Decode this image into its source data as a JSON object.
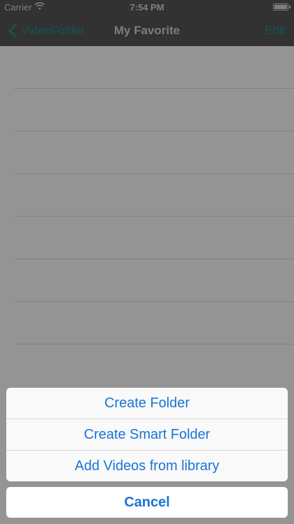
{
  "status_bar": {
    "carrier": "Carrier",
    "time": "7:54 PM",
    "wifi_icon": "wifi-icon",
    "battery_icon": "battery-icon"
  },
  "nav_bar": {
    "back_label": "VideoFolder",
    "title": "My Favorite",
    "edit_label": "Edit",
    "tint_color": "#1c8f8c"
  },
  "action_sheet": {
    "options": [
      {
        "label": "Create Folder"
      },
      {
        "label": "Create Smart Folder"
      },
      {
        "label": "Add Videos from library"
      }
    ],
    "cancel_label": "Cancel",
    "button_color": "#1a73d6"
  }
}
